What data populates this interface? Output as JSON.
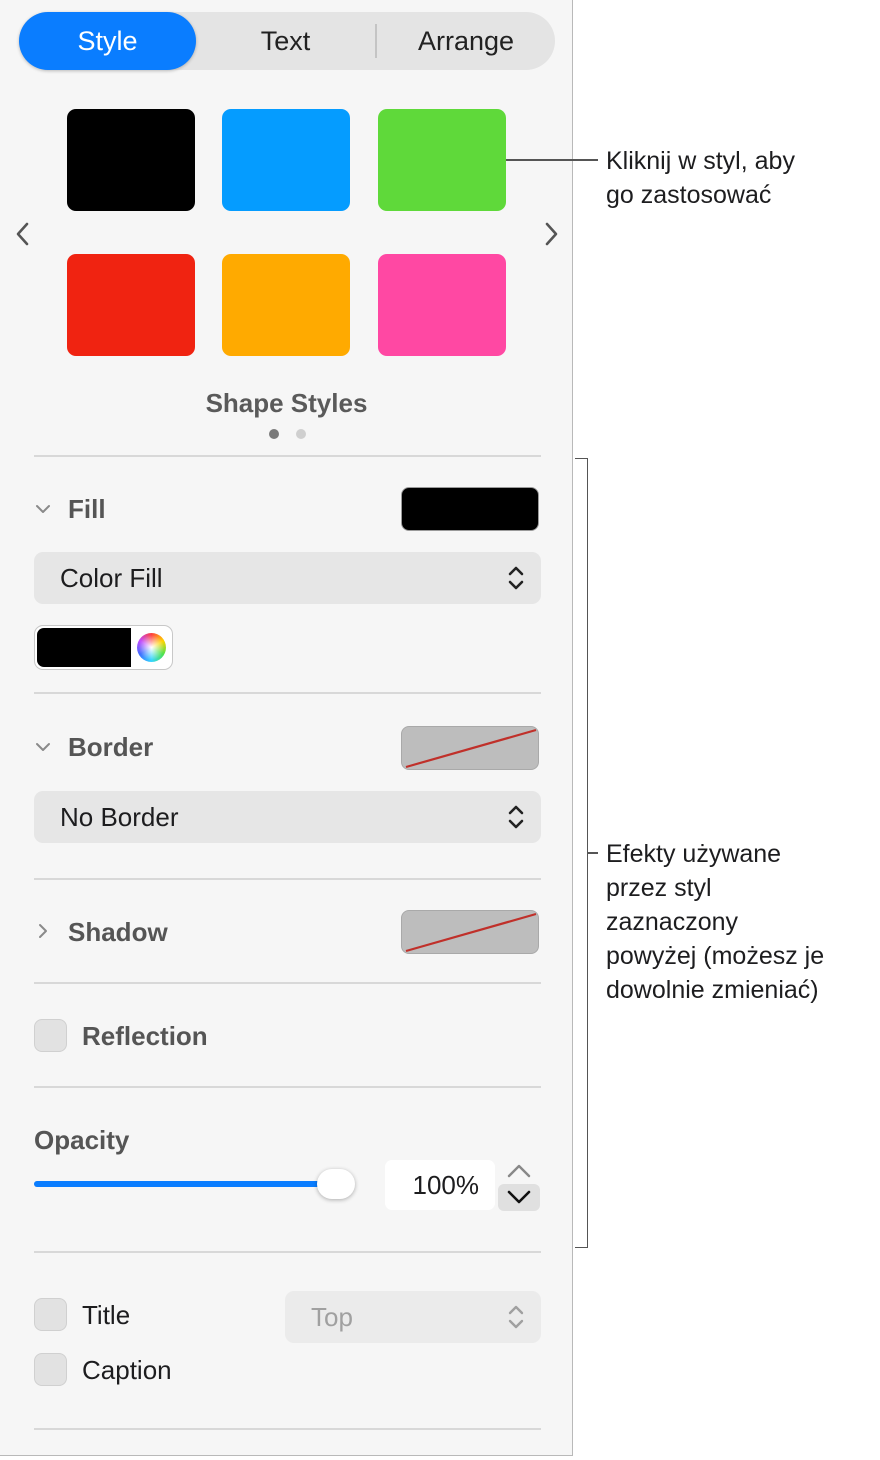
{
  "tabs": [
    {
      "label": "Style",
      "active": true
    },
    {
      "label": "Text",
      "active": false
    },
    {
      "label": "Arrange",
      "active": false
    }
  ],
  "styles": {
    "caption": "Shape Styles",
    "swatch_colors": [
      "#000000",
      "#059cff",
      "#5fd93a",
      "#f02311",
      "#ffaa00",
      "#ff48a3"
    ],
    "page": {
      "current": 1,
      "total": 2
    }
  },
  "fill": {
    "title": "Fill",
    "well_color": "#000000",
    "type_label": "Color Fill",
    "color": "#000000"
  },
  "border": {
    "title": "Border",
    "type_label": "No Border"
  },
  "shadow": {
    "title": "Shadow"
  },
  "reflection": {
    "label": "Reflection",
    "checked": false
  },
  "opacity": {
    "title": "Opacity",
    "value_label": "100%",
    "fraction": 1.0
  },
  "title_option": {
    "label": "Title",
    "checked": false,
    "position_label": "Top"
  },
  "caption_option": {
    "label": "Caption",
    "checked": false
  },
  "callouts": {
    "styles_note": [
      "Kliknij w styl, aby",
      "go zastosować"
    ],
    "effects_note": [
      "Efekty używane",
      "przez styl",
      "zaznaczony",
      "powyżej (możesz je",
      "dowolnie zmieniać)"
    ]
  },
  "colors": {
    "accent": "#0a7dff",
    "slash": "#c0302a"
  }
}
